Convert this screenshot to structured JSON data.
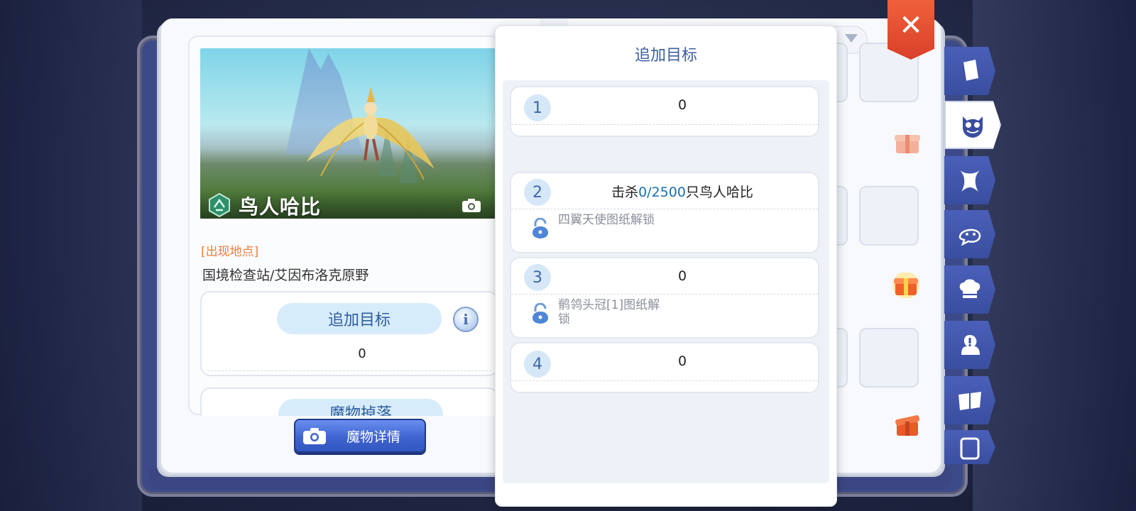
{
  "monster": {
    "name": "鸟人哈比",
    "location_label": "[出现地点]",
    "location_value": "国境检查站/艾因布洛克原野"
  },
  "left_panel": {
    "add_target_label": "追加目标",
    "info_glyph": "i",
    "target_count": "0",
    "second_section_label": "魔物掉落",
    "detail_button_label": "魔物详情"
  },
  "popup": {
    "title": "追加目标",
    "targets": [
      {
        "num": "1",
        "value": "0"
      },
      {
        "num": "2",
        "prefix": "击杀",
        "progress": "0/2500",
        "suffix": "只鸟人哈比",
        "reward": "四翼天使图纸解锁"
      },
      {
        "num": "3",
        "value": "0",
        "reward": "鹡鸰头冠[1]图纸解锁"
      },
      {
        "num": "4",
        "value": "0"
      }
    ]
  },
  "close_glyph": "✕",
  "side_tabs": [
    {
      "icon": "book-icon",
      "active": false
    },
    {
      "icon": "monster-face-icon",
      "active": true
    },
    {
      "icon": "horns-icon",
      "active": false
    },
    {
      "icon": "pet-icon",
      "active": false
    },
    {
      "icon": "chef-hat-icon",
      "active": false
    },
    {
      "icon": "head-exclaim-icon",
      "active": false
    },
    {
      "icon": "open-book-icon",
      "active": false
    },
    {
      "icon": "scroll-icon",
      "active": false
    }
  ],
  "colors": {
    "accent_blue": "#3d5f9d",
    "location_orange": "#ef7d3b",
    "progress_blue": "#1a6fb0",
    "close_red": "#d9402a",
    "tab_blue": "#3a4ea0"
  }
}
